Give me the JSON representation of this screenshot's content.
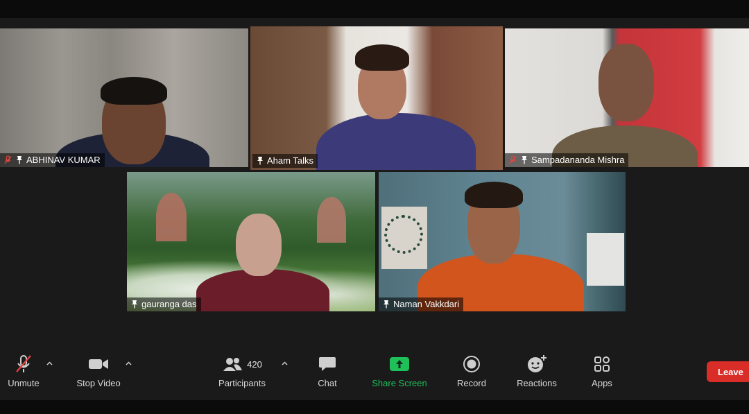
{
  "participants": [
    {
      "name": "ABHINAV KUMAR",
      "muted": true,
      "pinned": true
    },
    {
      "name": "Aham Talks",
      "muted": false,
      "pinned": true,
      "active_speaker": true
    },
    {
      "name": "Sampadananda Mishra",
      "muted": true,
      "pinned": true
    },
    {
      "name": "gauranga das",
      "muted": false,
      "pinned": true
    },
    {
      "name": "Naman Vakkdari",
      "muted": false,
      "pinned": true
    }
  ],
  "toolbar": {
    "unmute_label": "Unmute",
    "stop_video_label": "Stop Video",
    "participants_label": "Participants",
    "participants_count": "420",
    "chat_label": "Chat",
    "share_screen_label": "Share Screen",
    "record_label": "Record",
    "reactions_label": "Reactions",
    "apps_label": "Apps",
    "leave_label": "Leave"
  },
  "colors": {
    "active_speaker_border": "#b6e05a",
    "share_screen_green": "#1fbf5a",
    "leave_red": "#d92d27",
    "mute_red": "#e0443e"
  }
}
